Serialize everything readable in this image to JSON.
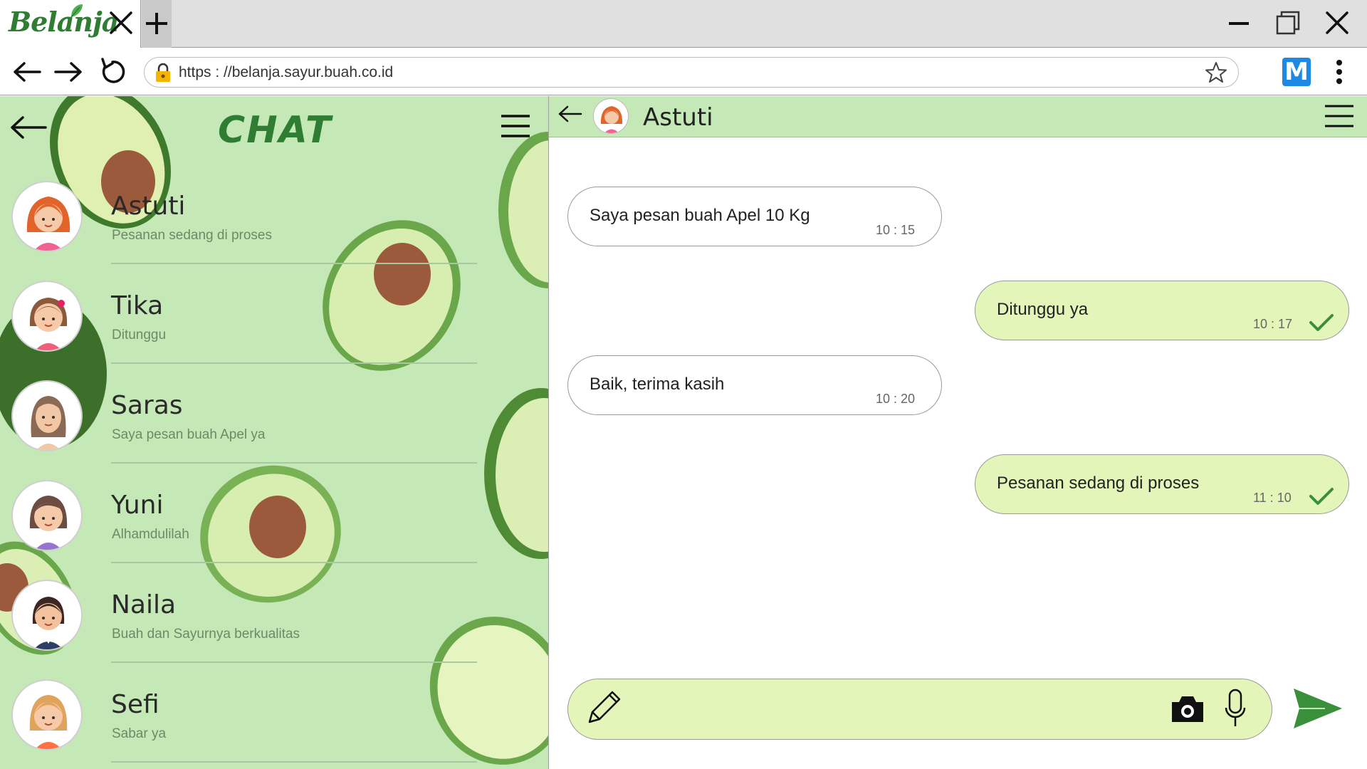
{
  "browser": {
    "tab": {
      "logo_text": "Belanja"
    },
    "url": "https : //belanja.sayur.buah.co.id",
    "extension_label": "M",
    "icons": [
      "close-icon",
      "plus-icon",
      "minimize-icon",
      "restore-icon",
      "window-close-icon",
      "back-arrow-icon",
      "forward-arrow-icon",
      "reload-icon",
      "lock-icon",
      "star-icon",
      "kebab-menu-icon"
    ]
  },
  "sidebar": {
    "title": "CHAT",
    "contacts": [
      {
        "name": "Astuti",
        "preview": "Pesanan sedang di proses"
      },
      {
        "name": "Tika",
        "preview": "Ditunggu"
      },
      {
        "name": "Saras",
        "preview": "Saya pesan buah Apel ya"
      },
      {
        "name": "Yuni",
        "preview": "Alhamdulilah"
      },
      {
        "name": "Naila",
        "preview": "Buah dan Sayurnya berkualitas"
      },
      {
        "name": "Sefi",
        "preview": "Sabar ya"
      }
    ]
  },
  "conversation": {
    "contact_name": "Astuti",
    "messages": [
      {
        "direction": "in",
        "text": "Saya pesan buah Apel 10 Kg",
        "time": "10 : 15"
      },
      {
        "direction": "out",
        "text": "Ditunggu ya",
        "time": "10 : 17",
        "read": true
      },
      {
        "direction": "in",
        "text": "Baik, terima kasih",
        "time": "10 : 20"
      },
      {
        "direction": "out",
        "text": "Pesanan sedang di proses",
        "time": "11 : 10",
        "read": true
      }
    ],
    "composer": {
      "placeholder": ""
    }
  },
  "colors": {
    "brand_green": "#2e7d32",
    "panel_green": "#c5e8b7",
    "outgoing_bubble": "#e4f5b9",
    "send_green": "#3a8f3a",
    "extension_blue": "#1e88e5"
  }
}
